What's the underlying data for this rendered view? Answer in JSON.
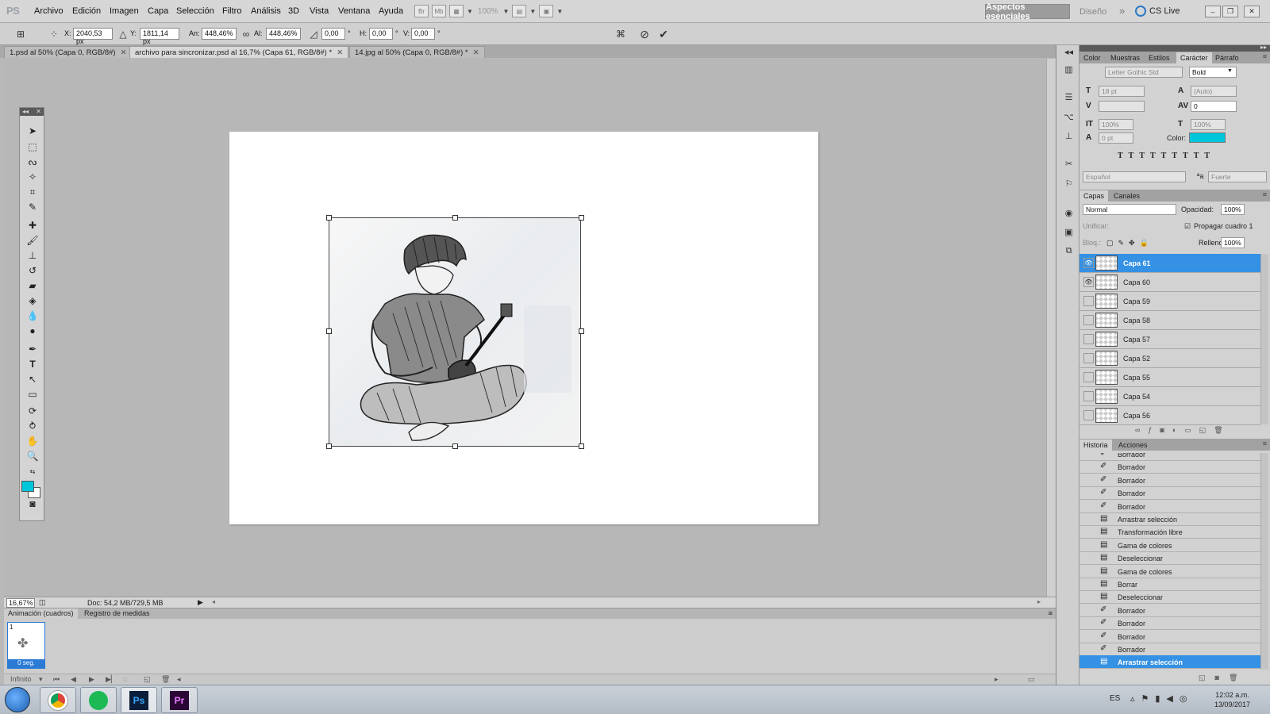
{
  "app": {
    "logo": "PS",
    "menu": [
      "Archivo",
      "Edición",
      "Imagen",
      "Capa",
      "Selección",
      "Filtro",
      "Análisis",
      "3D",
      "Vista",
      "Ventana",
      "Ayuda"
    ],
    "zoom_dropdown": "100%",
    "workspace_active": "Aspectos esenciales",
    "workspace_other": "Diseño",
    "cs_live": "CS Live"
  },
  "options": {
    "x_label": "X:",
    "x_value": "2040,53 px",
    "y_label": "Y:",
    "y_value": "1811,14 px",
    "w_label": "An:",
    "w_value": "448,46%",
    "h_label": "Al:",
    "h_value": "448,46%",
    "angle_value": "0,00",
    "hskew_label": "H:",
    "hskew_value": "0,00",
    "vskew_label": "V:",
    "vskew_value": "0,00",
    "degree": "°"
  },
  "tabs": [
    {
      "label": "1.psd al 50% (Capa 0, RGB/8#)",
      "active": false
    },
    {
      "label": "archivo para sincronizar.psd al 16,7% (Capa 61, RGB/8#) *",
      "active": true
    },
    {
      "label": "14.jpg al 50% (Capa 0, RGB/8#) *",
      "active": false
    }
  ],
  "status": {
    "zoom": "16,67%",
    "doc": "Doc: 54,2 MB/729,5 MB"
  },
  "animation": {
    "tabs": [
      "Animación (cuadros)",
      "Registro de medidas"
    ],
    "frame_number": "1",
    "frame_time": "0 seg.",
    "loop": "Infinito"
  },
  "character": {
    "tabs": [
      "Color",
      "Muestras",
      "Estilos",
      "Carácter",
      "Párrafo"
    ],
    "font_family": "Letter Gothic Std",
    "font_style": "Bold",
    "size": "18 pt",
    "leading": "(Auto)",
    "tracking": "0",
    "vscale": "100%",
    "hscale": "100%",
    "baseline": "0 pt",
    "color_label": "Color:",
    "color": "#00c6dc",
    "language": "Español",
    "antialias": "Fuerte"
  },
  "layers": {
    "tabs": [
      "Capas",
      "Canales"
    ],
    "blend_mode": "Normal",
    "opacity_label": "Opacidad:",
    "opacity": "100%",
    "unify_label": "Unificar:",
    "propagate_label": "Propagar cuadro 1",
    "lock_label": "Bloq.:",
    "fill_label": "Relleno:",
    "fill": "100%",
    "items": [
      {
        "name": "Capa 61",
        "visible": true,
        "selected": true
      },
      {
        "name": "Capa 60",
        "visible": true,
        "selected": false
      },
      {
        "name": "Capa 59",
        "visible": false,
        "selected": false
      },
      {
        "name": "Capa 58",
        "visible": false,
        "selected": false
      },
      {
        "name": "Capa 57",
        "visible": false,
        "selected": false
      },
      {
        "name": "Capa 52",
        "visible": false,
        "selected": false
      },
      {
        "name": "Capa 55",
        "visible": false,
        "selected": false
      },
      {
        "name": "Capa 54",
        "visible": false,
        "selected": false
      },
      {
        "name": "Capa 56",
        "visible": false,
        "selected": false
      }
    ]
  },
  "history": {
    "tabs": [
      "Historia",
      "Acciones"
    ],
    "items": [
      {
        "name": "Borrador",
        "icon": "eraser-icon",
        "selected": false
      },
      {
        "name": "Borrador",
        "icon": "eraser-icon",
        "selected": false
      },
      {
        "name": "Borrador",
        "icon": "eraser-icon",
        "selected": false
      },
      {
        "name": "Borrador",
        "icon": "eraser-icon",
        "selected": false
      },
      {
        "name": "Borrador",
        "icon": "eraser-icon",
        "selected": false
      },
      {
        "name": "Arrastrar selección",
        "icon": "action-icon",
        "selected": false
      },
      {
        "name": "Transformación libre",
        "icon": "action-icon",
        "selected": false
      },
      {
        "name": "Gama de colores",
        "icon": "action-icon",
        "selected": false
      },
      {
        "name": "Deseleccionar",
        "icon": "action-icon",
        "selected": false
      },
      {
        "name": "Gama de colores",
        "icon": "action-icon",
        "selected": false
      },
      {
        "name": "Borrar",
        "icon": "action-icon",
        "selected": false
      },
      {
        "name": "Deseleccionar",
        "icon": "action-icon",
        "selected": false
      },
      {
        "name": "Borrador",
        "icon": "eraser-icon",
        "selected": false
      },
      {
        "name": "Borrador",
        "icon": "eraser-icon",
        "selected": false
      },
      {
        "name": "Borrador",
        "icon": "eraser-icon",
        "selected": false
      },
      {
        "name": "Borrador",
        "icon": "eraser-icon",
        "selected": false
      },
      {
        "name": "Arrastrar selección",
        "icon": "action-icon",
        "selected": true
      }
    ]
  },
  "taskbar": {
    "lang": "ES",
    "time": "12:02 a.m.",
    "date": "13/09/2017",
    "apps": [
      "chrome-icon",
      "spotify-icon",
      "photoshop-icon",
      "premiere-icon"
    ],
    "ps_label": "Ps",
    "pr_label": "Pr"
  },
  "colors": {
    "accent": "#3491e4",
    "foreground_swatch": "#00c6dc",
    "background_swatch": "#ffffff"
  }
}
